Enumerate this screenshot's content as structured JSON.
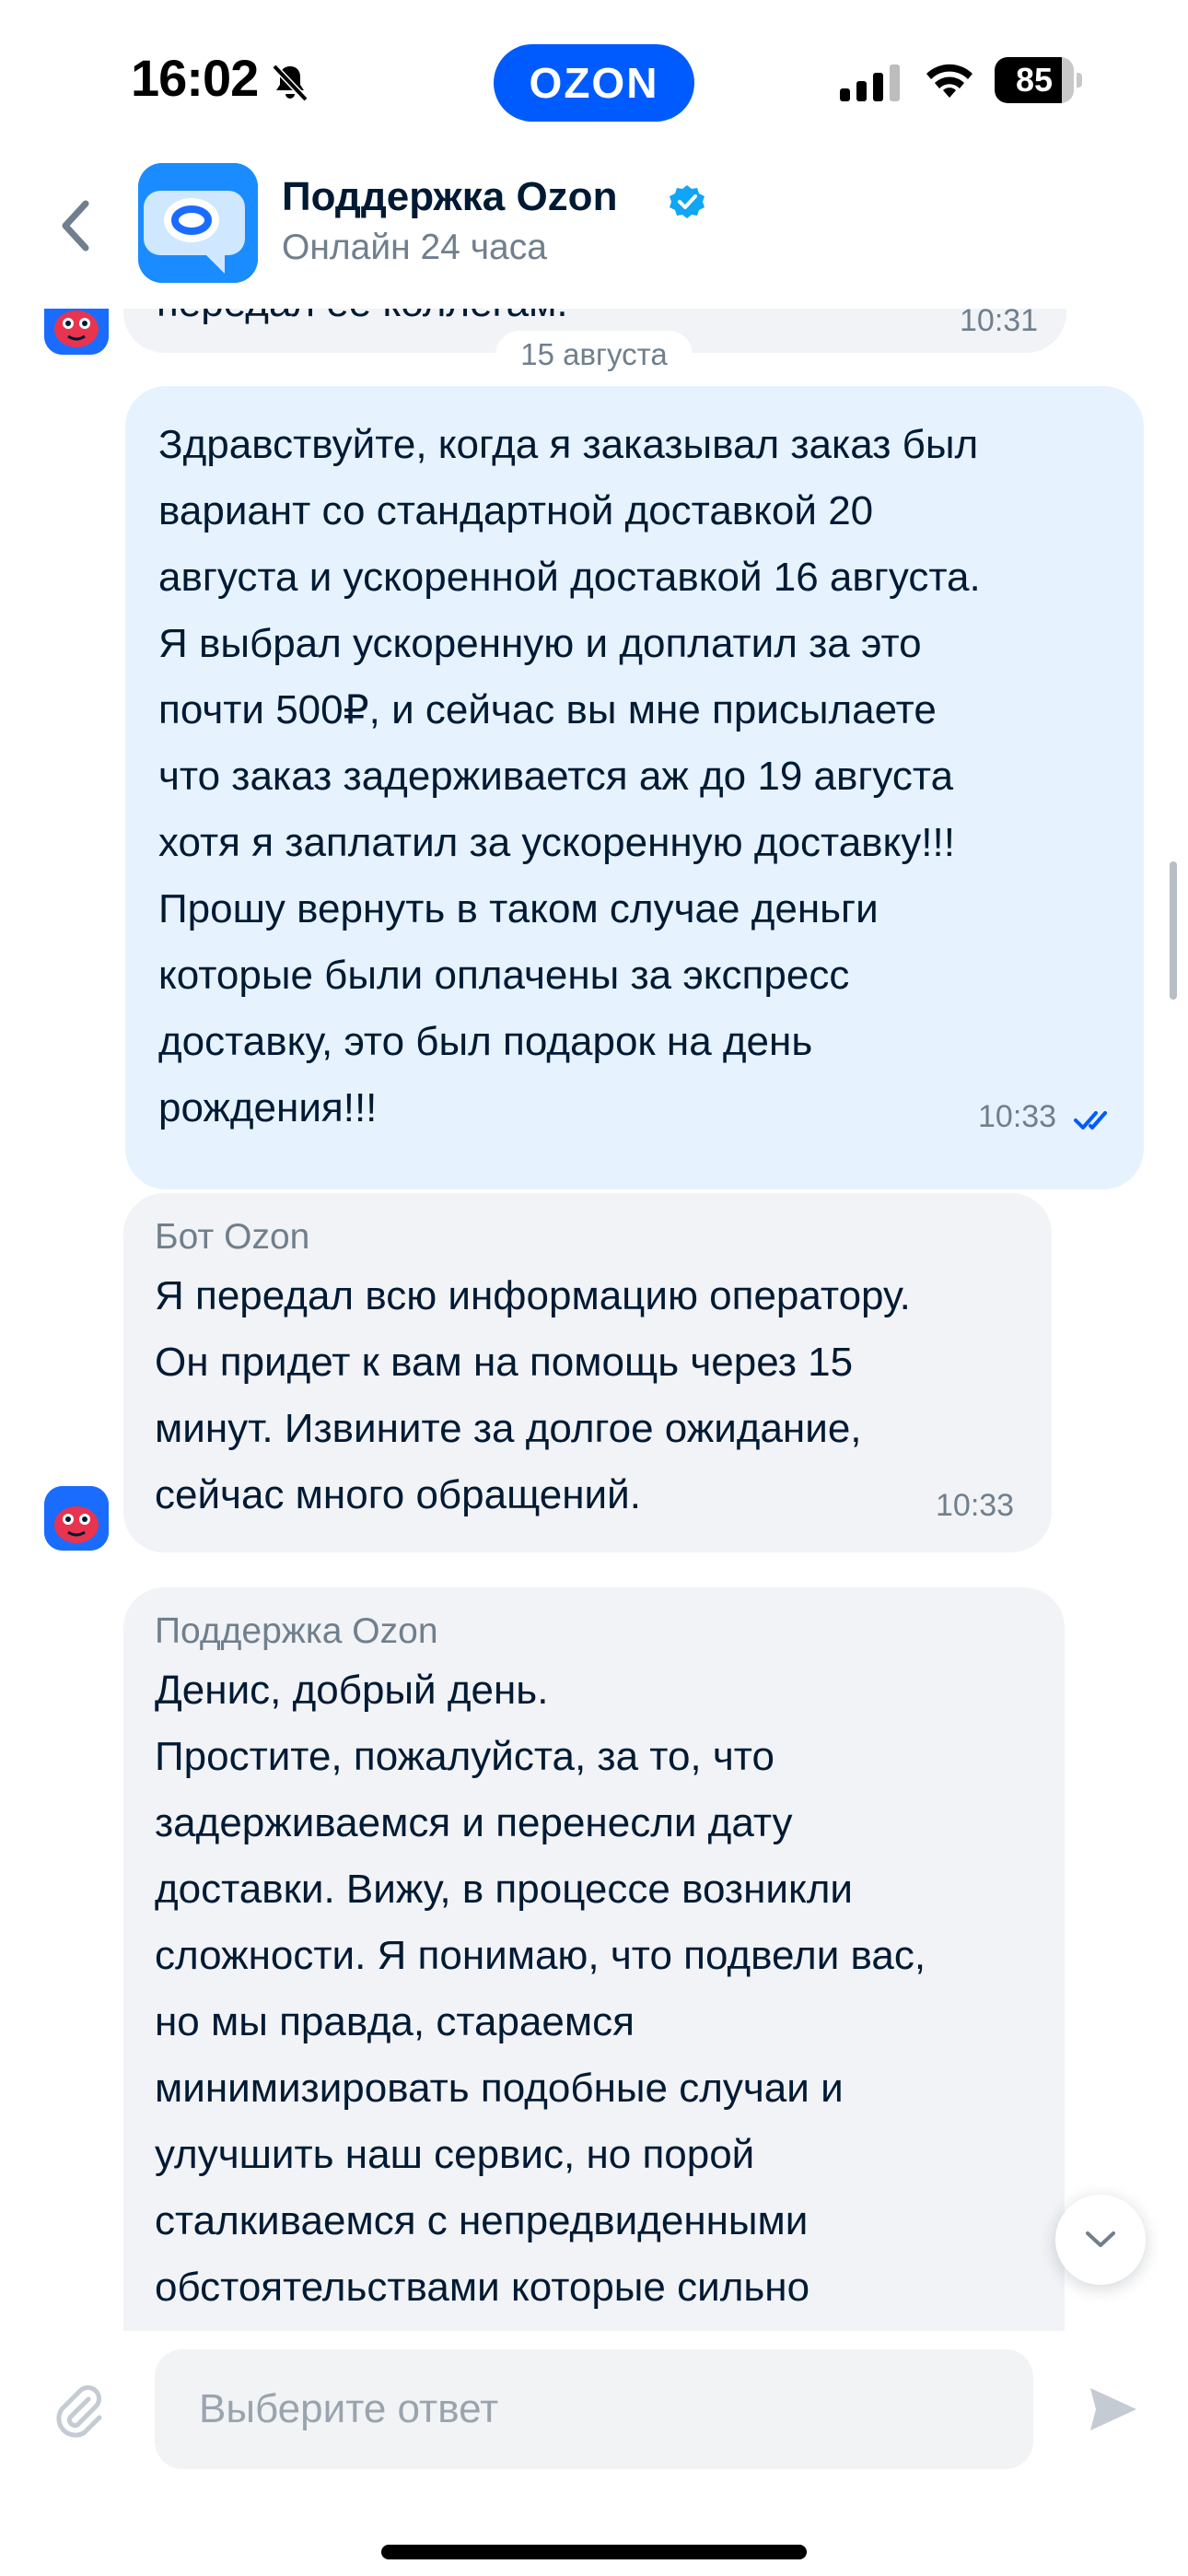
{
  "status_bar": {
    "time": "16:02",
    "app_badge": "OZON",
    "battery_percent": "85",
    "battery_level": 0.85
  },
  "header": {
    "title": "Поддержка Ozon",
    "subtitle": "Онлайн 24 часа"
  },
  "messages": {
    "previous_partial_text": "передал ее коллегам.",
    "previous_partial_time": "10:31",
    "date_separator": "15 августа",
    "outgoing": {
      "text": "Здравствуйте, когда я заказывал заказ был\nвариант со стандартной доставкой 20\nавгуста и ускоренной доставкой 16 августа.\nЯ выбрал ускоренную и доплатил за это\nпочти 500₽, и сейчас вы мне присылаете\nчто заказ задерживается аж до 19 августа\nхотя я заплатил за ускоренную доставку!!!\nПрошу вернуть в таком случае деньги\nкоторые были оплачены за экспресс\nдоставку, это был подарок на день\nрождения!!!",
      "time": "10:33"
    },
    "bot": {
      "sender": "Бот Ozon",
      "text": "Я передал всю информацию оператору.\nОн придет к вам на помощь через 15\nминут. Извините за долгое ожидание,\nсейчас много обращений.",
      "time": "10:33"
    },
    "support": {
      "sender": "Поддержка Ozon",
      "text": "Денис, добрый день.\nПростите, пожалуйста, за то, что\nзадерживаемся и перенесли дату\nдоставки. Вижу, в процессе возникли\nсложности. Я понимаю, что подвели вас,\nно мы правда, стараемся\nминимизировать подобные случаи и\nулучшить наш сервис, но порой\nсталкиваемся с непредвиденными\nобстоятельствами которые сильно"
    }
  },
  "composer": {
    "placeholder": "Выберите ответ"
  },
  "colors": {
    "brand": "#005bff",
    "outgoing_bubble": "#e6f3ff",
    "incoming_bubble": "#f1f3f6",
    "read_check": "#005bff"
  }
}
